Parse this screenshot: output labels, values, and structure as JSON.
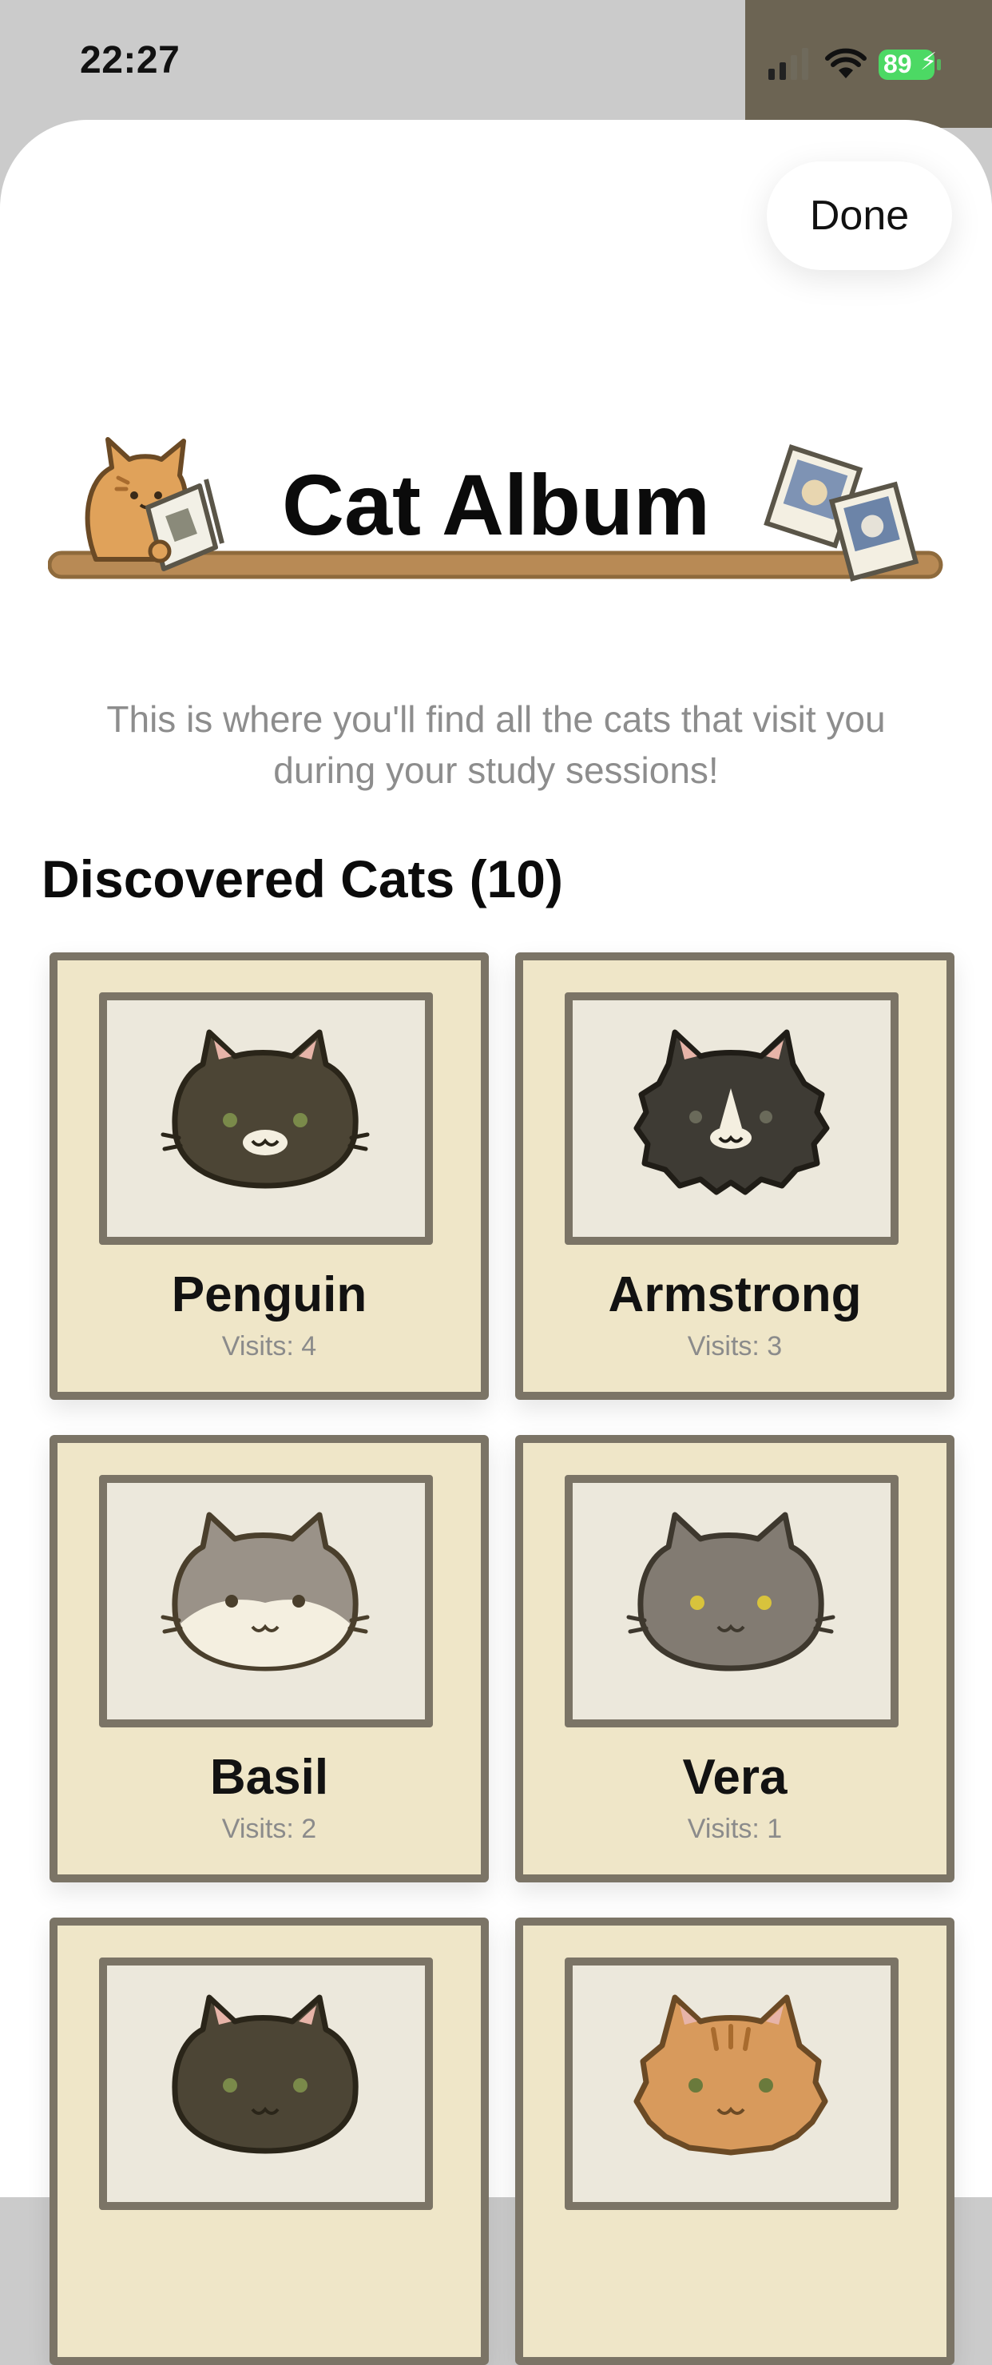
{
  "status_bar": {
    "time": "22:27",
    "battery": "89"
  },
  "header": {
    "done_label": "Done",
    "title": "Cat Album"
  },
  "intro": {
    "text": "This is where you'll find all the cats that visit you during your study sessions!"
  },
  "section": {
    "heading": "Discovered Cats (10)"
  },
  "cats": [
    {
      "name": "Penguin",
      "visits": "Visits: 4",
      "icon": "black-white-cat-face-icon",
      "fur": "#4c4535",
      "eye": "#7a8a4a"
    },
    {
      "name": "Armstrong",
      "visits": "Visits: 3",
      "icon": "fluffy-black-cat-face-icon",
      "fur": "#3e3b34",
      "eye": "#6a6a5a"
    },
    {
      "name": "Basil",
      "visits": "Visits: 2",
      "icon": "gray-white-cat-face-icon",
      "fur": "#9a9288",
      "eye": "#4a3f2c"
    },
    {
      "name": "Vera",
      "visits": "Visits: 1",
      "icon": "gray-cat-face-icon",
      "fur": "#827b72",
      "eye": "#d8c33c"
    },
    {
      "name": "",
      "visits": "",
      "icon": "dark-cat-face-icon",
      "fur": "#4c4535",
      "eye": "#7a8a4a"
    },
    {
      "name": "",
      "visits": "",
      "icon": "orange-tabby-cat-face-icon",
      "fur": "#d89a5c",
      "eye": "#6a7a3c"
    }
  ],
  "colors": {
    "card_bg": "#efe6c8",
    "card_border": "#7b7466",
    "frame_bg": "#ece8dc",
    "shelf": "#b88a55",
    "status_right_bg": "#6c6453",
    "battery_green": "#4cd964"
  }
}
